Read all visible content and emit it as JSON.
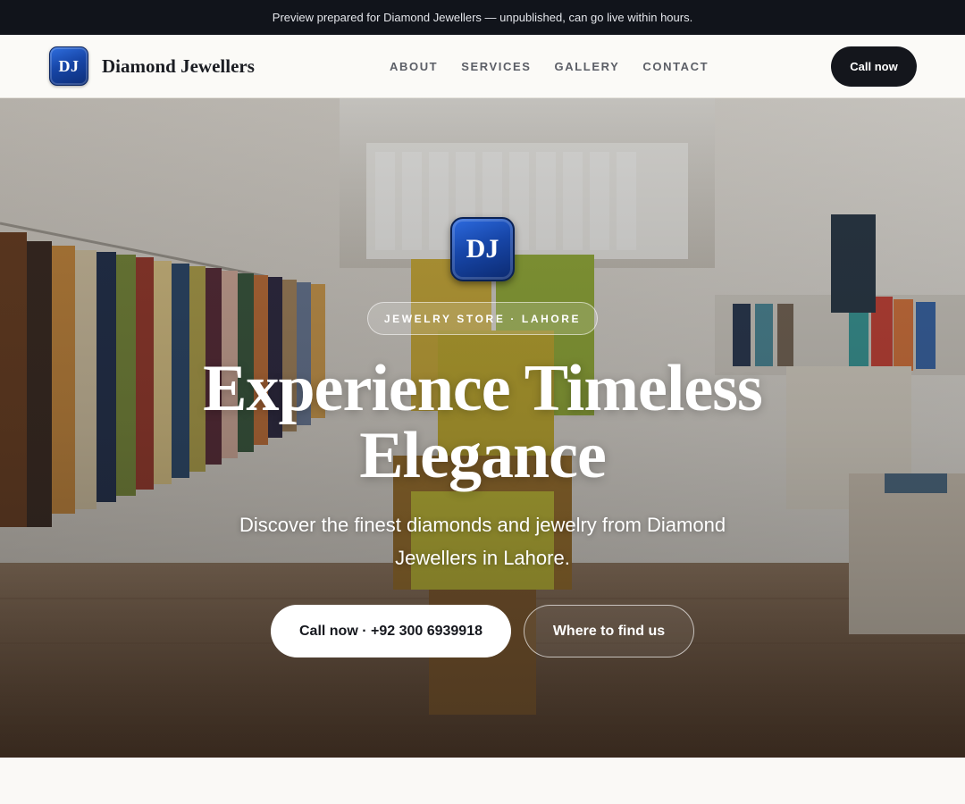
{
  "topbar": {
    "text": "Preview prepared for Diamond Jewellers — unpublished, can go live within hours."
  },
  "navbar": {
    "logo_text": "DJ",
    "brand_name": "Diamond Jewellers",
    "links": [
      "ABOUT",
      "SERVICES",
      "GALLERY",
      "CONTACT"
    ],
    "cta_label": "Call now"
  },
  "hero": {
    "logo_text": "DJ",
    "tag": "JEWELRY STORE · LAHORE",
    "title": "Experience Timeless Elegance",
    "subtitle": "Discover the finest diamonds and jewelry from Diamond Jewellers in Lahore.",
    "primary_button": "Call now · +92 300 6939918",
    "secondary_button": "Where to find us"
  },
  "colors": {
    "topbar_bg": "#11141b",
    "cta_bg": "#14161c",
    "logo_blue": "#1746a8",
    "page_bg": "#faf9f6"
  }
}
